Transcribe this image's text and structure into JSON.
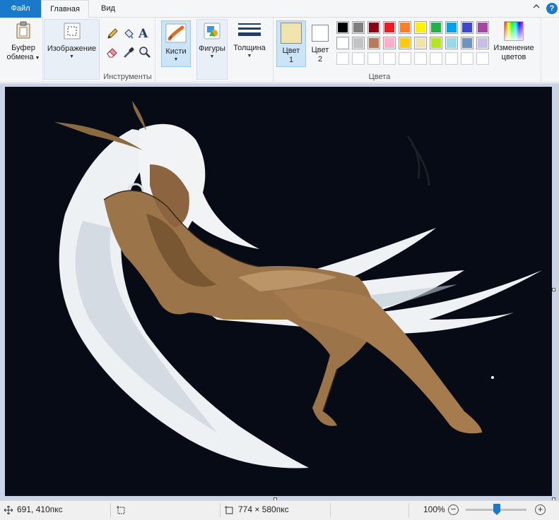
{
  "tabs": {
    "file": "Файл",
    "home": "Главная",
    "view": "Вид"
  },
  "ribbon": {
    "clipboard": {
      "label": "Буфер\nобмена",
      "line1": "Буфер",
      "line2": "обмена"
    },
    "image": {
      "label": "Изображение"
    },
    "tools": {
      "group_label": "Инструменты",
      "items": [
        "pencil-icon",
        "fill-icon",
        "text-icon",
        "eraser-icon",
        "color-picker-icon",
        "magnifier-icon"
      ]
    },
    "brushes": {
      "label": "Кисти"
    },
    "shapes": {
      "label": "Фигуры"
    },
    "size": {
      "label": "Толщина"
    },
    "color1": {
      "line1": "Цвет",
      "line2": "1",
      "value": "#efe4b0"
    },
    "color2": {
      "line1": "Цвет",
      "line2": "2",
      "value": "#ffffff"
    },
    "colors_group_label": "Цвета",
    "edit_colors": {
      "line1": "Изменение",
      "line2": "цветов"
    },
    "palette_row1": [
      "#000000",
      "#7f7f7f",
      "#880015",
      "#ed1c24",
      "#ff7f27",
      "#fff200",
      "#22b14c",
      "#00a2e8",
      "#3f48cc",
      "#a349a4"
    ],
    "palette_row2": [
      "#ffffff",
      "#c3c3c3",
      "#b97a57",
      "#ffaec9",
      "#ffc90e",
      "#efe4b0",
      "#b5e61d",
      "#99d9ea",
      "#7092be",
      "#c8bfe7"
    ],
    "palette_row3": [
      "#ffffff",
      "#ffffff",
      "#ffffff",
      "#ffffff",
      "#ffffff",
      "#ffffff",
      "#ffffff",
      "#ffffff",
      "#ffffff",
      "#ffffff"
    ]
  },
  "status": {
    "cursor_pos": "691, 410пкс",
    "selection_size": "",
    "image_size": "774 × 580пкс",
    "zoom": "100%"
  }
}
